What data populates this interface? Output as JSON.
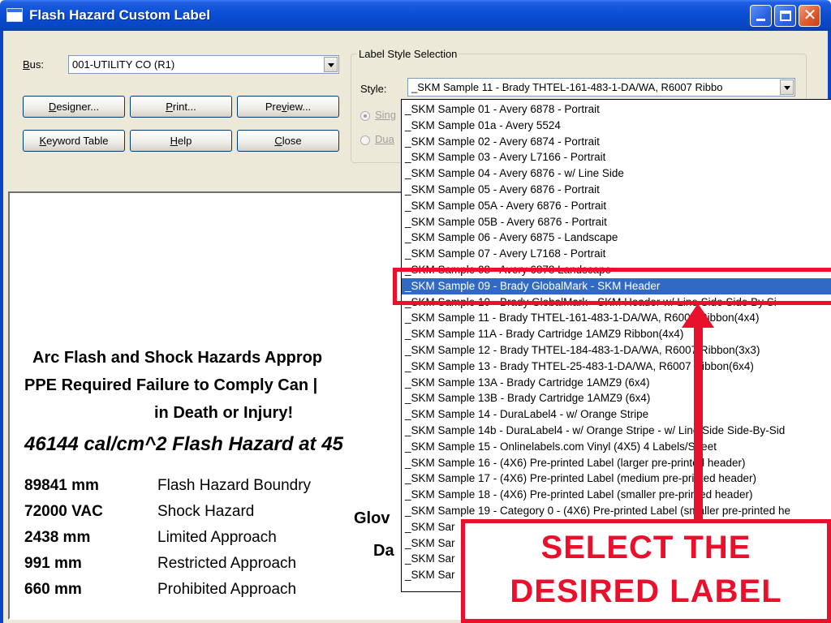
{
  "window": {
    "title": "Flash Hazard Custom Label",
    "colors": {
      "titlebar": "#0a4ed4",
      "face": "#ece9d8",
      "selection": "#316ac5",
      "annotation": "#e8102a"
    }
  },
  "bus": {
    "label_prefix": "B",
    "label_rest": "us:",
    "value": "001-UTILITY CO  (R1)"
  },
  "buttons": {
    "designer": {
      "u": "D",
      "rest": "esigner..."
    },
    "print": {
      "u": "P",
      "rest": "rint..."
    },
    "preview": {
      "pre": "Pre",
      "u": "v",
      "rest": "iew..."
    },
    "keyword": {
      "u": "K",
      "rest": "eyword Table"
    },
    "help": {
      "u": "H",
      "rest": "elp"
    },
    "close": {
      "u": "C",
      "rest": "lose"
    }
  },
  "label_style": {
    "group_title": "Label Style Selection",
    "style_label": "Style:",
    "style_value": "_SKM Sample 11 - Brady THTEL-161-483-1-DA/WA, R6007 Ribbo",
    "single_partial": "Sing",
    "dual_partial": "Dua"
  },
  "preview": {
    "heading1": "Arc Flash and Shock Hazards Approp",
    "heading2": "PPE Required Failure to Comply Can |",
    "heading3": "in Death or Injury!",
    "flash_line": "46144 cal/cm^2  Flash Hazard at 45",
    "rows": [
      {
        "value": "89841 mm",
        "desc": "Flash Hazard Boundry"
      },
      {
        "value": "72000 VAC",
        "desc": "Shock Hazard"
      },
      {
        "value": "2438 mm",
        "desc": "Limited Approach"
      },
      {
        "value": "991 mm",
        "desc": "Restricted Approach"
      },
      {
        "value": "660 mm",
        "desc": "Prohibited Approach"
      }
    ],
    "glove_partial": "Glov",
    "da_partial": "Da"
  },
  "dropdown": {
    "items": [
      "_SKM Sample 01 - Avery 6878 - Portrait",
      "_SKM Sample 01a - Avery 5524",
      "_SKM Sample 02 - Avery 6874 - Portrait",
      "_SKM Sample 03 - Avery L7166 - Portrait",
      "_SKM Sample 04 - Avery 6876 - w/ Line Side",
      "_SKM Sample 05 - Avery 6876 - Portrait",
      "_SKM Sample 05A - Avery 6876 - Portrait",
      "_SKM Sample 05B - Avery 6876 - Portrait",
      "_SKM Sample 06 - Avery 6875 - Landscape",
      "_SKM Sample 07 - Avery L7168 - Portrait",
      "_SKM Sample 08 - Avery 6878 Landscape",
      "_SKM Sample 09 - Brady GlobalMark - SKM Header",
      "_SKM Sample 10 - Brady GlobalMark - SKM Header w/ Line Side Side By Si",
      "_SKM Sample 11 - Brady THTEL-161-483-1-DA/WA, R6007 Ribbon(4x4)",
      "_SKM Sample 11A - Brady Cartridge 1AMZ9  Ribbon(4x4)",
      "_SKM Sample 12 - Brady THTEL-184-483-1-DA/WA, R6007 Ribbon(3x3)",
      "_SKM Sample 13 - Brady THTEL-25-483-1-DA/WA, R6007 Ribbon(6x4)",
      "_SKM Sample 13A - Brady Cartridge 1AMZ9 (6x4)",
      "_SKM Sample 13B - Brady Cartridge 1AMZ9 (6x4)",
      "_SKM Sample 14 - DuraLabel4 - w/ Orange Stripe",
      "_SKM Sample 14b - DuraLabel4 - w/ Orange Stripe - w/ Line Side Side-By-Sid",
      "_SKM Sample 15 - Onlinelabels.com Vinyl (4X5) 4 Labels/Sheet",
      "_SKM Sample 16 - (4X6) Pre-printed Label (larger pre-printed header)",
      "_SKM Sample 17 - (4X6) Pre-printed Label (medium pre-printed header)",
      "_SKM Sample 18 - (4X6) Pre-printed Label (smaller pre-printed header)",
      "_SKM Sample 19 - Category 0 - (4X6) Pre-printed Label (smaller pre-printed he",
      "_SKM Sar",
      "_SKM Sar",
      "_SKM Sar",
      "_SKM Sar"
    ],
    "selected_index": 11
  },
  "annotation": {
    "line1": "SELECT THE",
    "line2": "DESIRED LABEL"
  }
}
